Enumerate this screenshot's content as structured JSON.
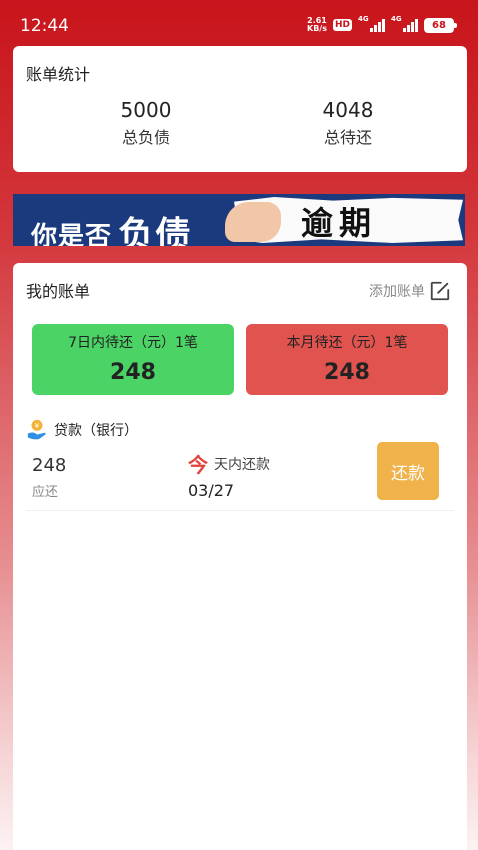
{
  "status_bar": {
    "time": "12:44",
    "net_speed_value": "2.61",
    "net_speed_unit": "KB/s",
    "hd_badge": "HD",
    "sim1_label": "4G",
    "sim2_label": "4G",
    "battery": "68"
  },
  "stats": {
    "title": "账单统计",
    "total_debt_value": "5000",
    "total_debt_label": "总负债",
    "total_pending_value": "4048",
    "total_pending_label": "总待还"
  },
  "banner": {
    "left_text": "你是否",
    "left_big_text": "负债",
    "right_text": "逾期"
  },
  "bills": {
    "title": "我的账单",
    "add_bill_label": "添加账单",
    "summary_7d_label": "7日内待还（元）1笔",
    "summary_7d_value": "248",
    "summary_month_label": "本月待还（元）1笔",
    "summary_month_value": "248",
    "items": [
      {
        "name": "贷款（银行）",
        "amount": "248",
        "amount_label": "应还",
        "due_badge": "今",
        "due_text": "天内还款",
        "due_date": "03/27",
        "pay_label": "还款"
      }
    ]
  },
  "colors": {
    "header_red": "#c8141b",
    "green_box": "#4bd465",
    "red_box": "#e0534e",
    "pay_button": "#f0b24a"
  },
  "icons": {
    "edit": "edit-icon",
    "loan": "loan-icon"
  }
}
